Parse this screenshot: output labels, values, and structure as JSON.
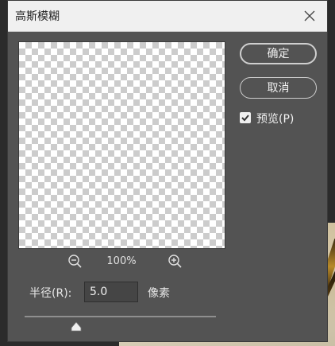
{
  "dialog": {
    "title": "高斯模糊"
  },
  "buttons": {
    "ok_label": "确定",
    "cancel_label": "取消"
  },
  "preview_option": {
    "label": "预览(P)",
    "checked": true
  },
  "zoom": {
    "level": "100%"
  },
  "radius": {
    "label": "半径(R):",
    "value": "5.0",
    "unit": "像素",
    "slider_fraction": 0.27
  },
  "icons": {
    "close": "close-icon",
    "zoom_out": "zoom-out-icon",
    "zoom_in": "zoom-in-icon",
    "check": "checkmark-icon",
    "slider_thumb": "triangle-up-icon"
  },
  "colors": {
    "dialog_bg": "#535353",
    "titlebar_bg": "#f0f0f0",
    "text": "#e6e6e6"
  }
}
